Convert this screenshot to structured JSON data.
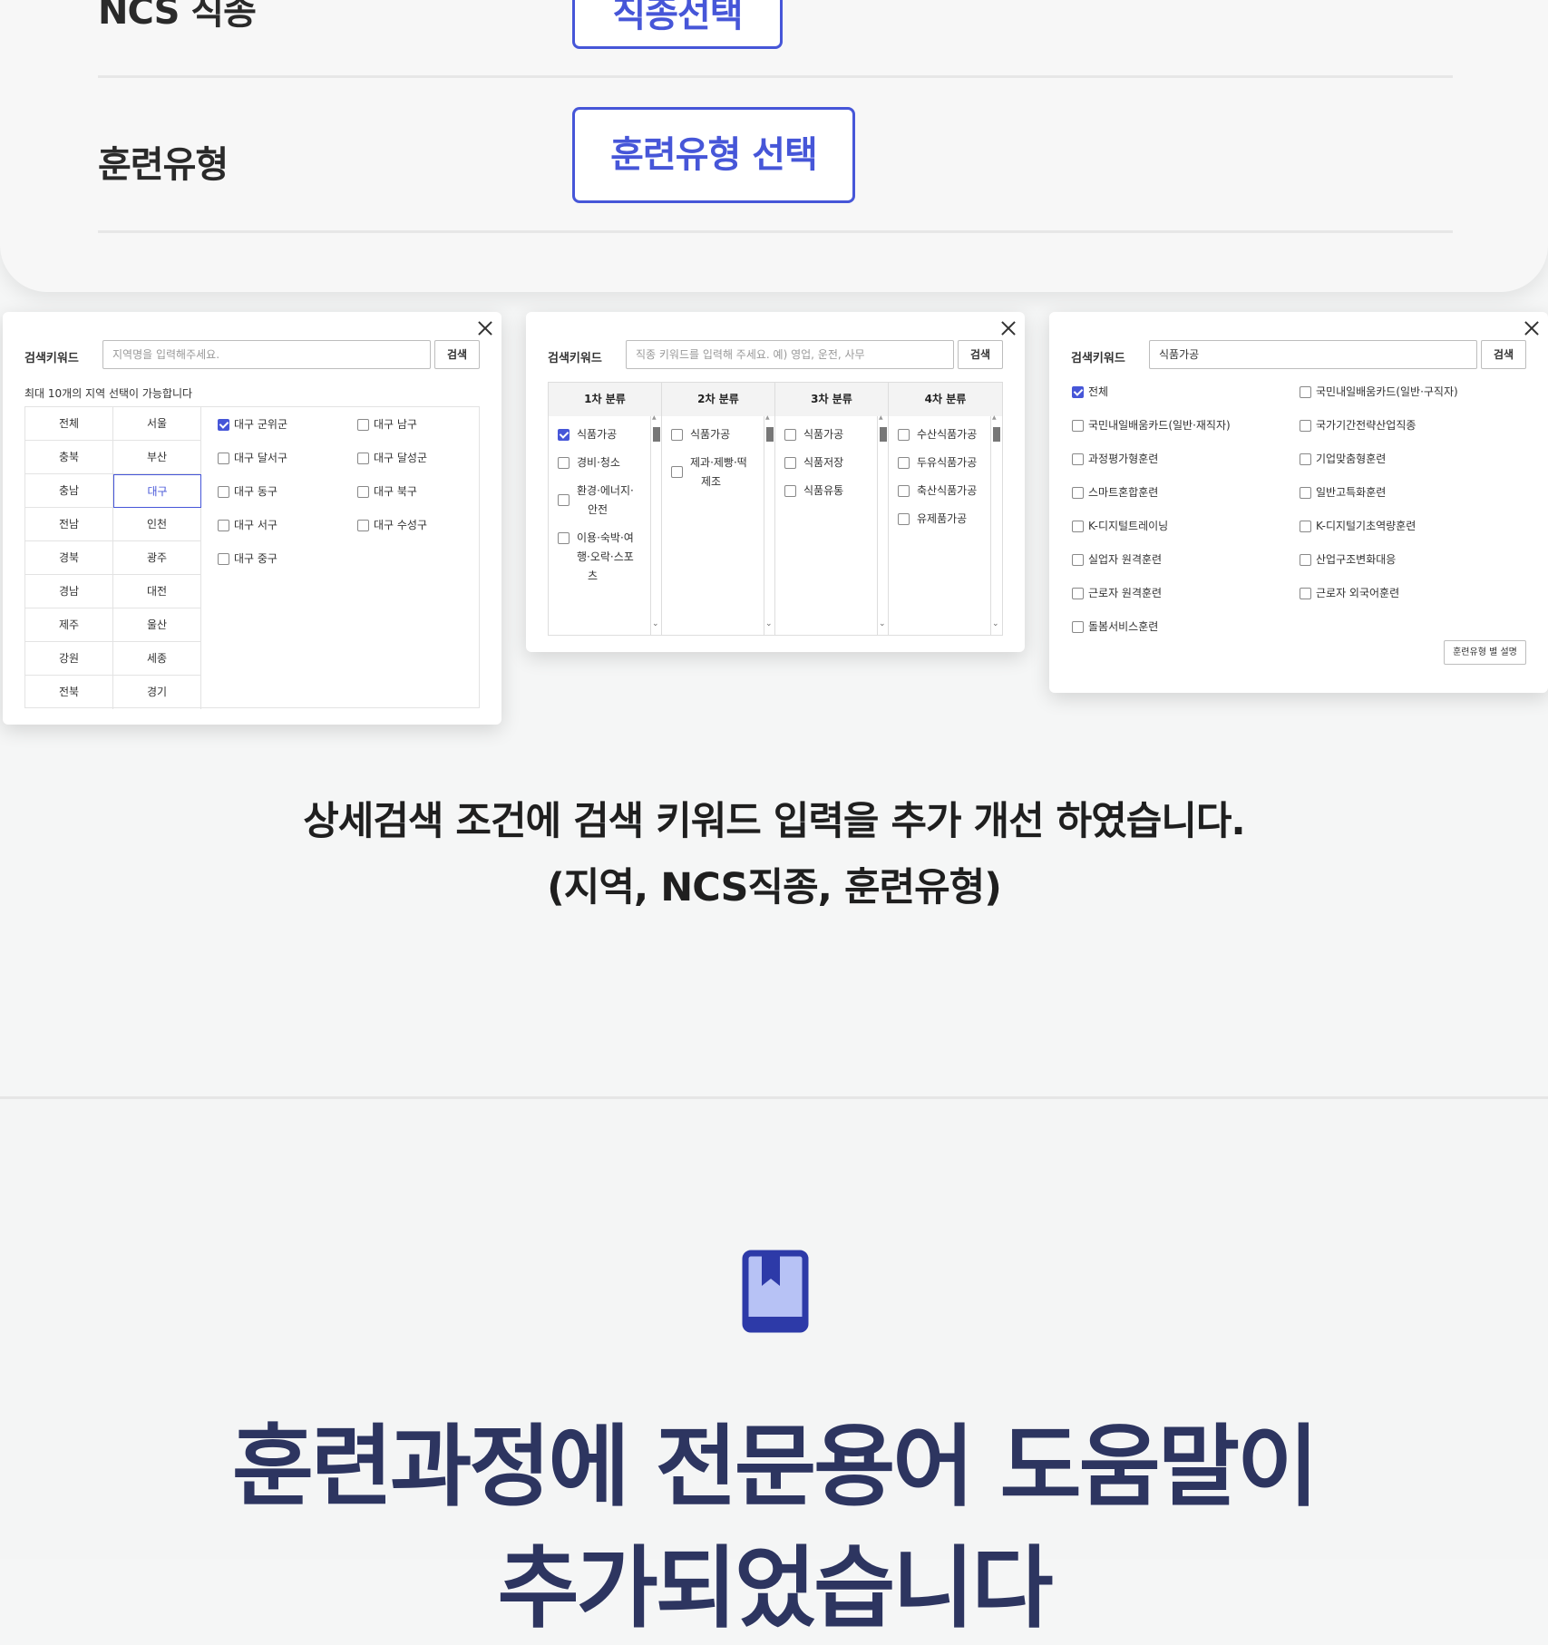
{
  "top_form": {
    "ncs_label": "NCS 직종",
    "ncs_button": "직종선택",
    "training_type_label": "훈련유형",
    "training_type_button": "훈련유형 선택"
  },
  "region_dialog": {
    "keyword_label": "검색키워드",
    "input_placeholder": "지역명을 입력해주세요.",
    "search_button": "검색",
    "note": "최대 10개의 지역 선택이 가능합니다",
    "regions_col1": [
      "전체",
      "충북",
      "충남",
      "전남",
      "경북",
      "경남",
      "제주",
      "강원",
      "전북"
    ],
    "regions_col2": [
      "서울",
      "부산",
      "대구",
      "인천",
      "광주",
      "대전",
      "울산",
      "세종",
      "경기"
    ],
    "selected_region": "대구",
    "districts": [
      {
        "label": "대구 군위군",
        "checked": true
      },
      {
        "label": "대구 남구",
        "checked": false
      },
      {
        "label": "대구 달서구",
        "checked": false
      },
      {
        "label": "대구 달성군",
        "checked": false
      },
      {
        "label": "대구 동구",
        "checked": false
      },
      {
        "label": "대구 북구",
        "checked": false
      },
      {
        "label": "대구 서구",
        "checked": false
      },
      {
        "label": "대구 수성구",
        "checked": false
      },
      {
        "label": "대구 중구",
        "checked": false
      }
    ]
  },
  "ncs_dialog": {
    "keyword_label": "검색키워드",
    "input_placeholder": "직종 키워드를 입력해 주세요. 예) 영업, 운전, 사무",
    "search_button": "검색",
    "col_headers": [
      "1차 분류",
      "2차 분류",
      "3차 분류",
      "4차 분류"
    ],
    "col1": [
      {
        "lines": [
          "식품가공"
        ],
        "checked": true
      },
      {
        "lines": [
          "경비·청소"
        ],
        "checked": false
      },
      {
        "lines": [
          "환경·에너지·",
          "안전"
        ],
        "checked": false
      },
      {
        "lines": [
          "이용·숙박·여",
          "행·오락·스포",
          "츠"
        ],
        "checked": false
      }
    ],
    "col2": [
      {
        "lines": [
          "식품가공"
        ],
        "checked": false
      },
      {
        "lines": [
          "제과·제빵·떡",
          "제조"
        ],
        "checked": false
      }
    ],
    "col3": [
      {
        "lines": [
          "식품가공"
        ],
        "checked": false
      },
      {
        "lines": [
          "식품저장"
        ],
        "checked": false
      },
      {
        "lines": [
          "식품유통"
        ],
        "checked": false
      }
    ],
    "col4": [
      {
        "lines": [
          "수산식품가공"
        ],
        "checked": false
      },
      {
        "lines": [
          "두유식품가공"
        ],
        "checked": false
      },
      {
        "lines": [
          "축산식품가공"
        ],
        "checked": false
      },
      {
        "lines": [
          "유제품가공"
        ],
        "checked": false
      }
    ]
  },
  "type_dialog": {
    "keyword_label": "검색키워드",
    "input_value": "식품가공",
    "search_button": "검색",
    "left_options": [
      {
        "label": "전체",
        "checked": true
      },
      {
        "label": "국민내일배움카드(일반·재직자)",
        "checked": false
      },
      {
        "label": "과정평가형훈련",
        "checked": false
      },
      {
        "label": "스마트혼합훈련",
        "checked": false
      },
      {
        "label": "K-디지털트레이닝",
        "checked": false
      },
      {
        "label": "실업자 원격훈련",
        "checked": false
      },
      {
        "label": "근로자 원격훈련",
        "checked": false
      },
      {
        "label": "돌봄서비스훈련",
        "checked": false
      }
    ],
    "right_options": [
      {
        "label": "국민내일배움카드(일반·구직자)",
        "checked": false
      },
      {
        "label": "국가기간전략산업직종",
        "checked": false
      },
      {
        "label": "기업맞춤형훈련",
        "checked": false
      },
      {
        "label": "일반고특화훈련",
        "checked": false
      },
      {
        "label": "K-디지털기초역량훈련",
        "checked": false
      },
      {
        "label": "산업구조변화대응",
        "checked": false
      },
      {
        "label": "근로자 외국어훈련",
        "checked": false
      }
    ],
    "explain_button": "훈련유형 별 설명"
  },
  "caption": {
    "line1": "상세검색 조건에 검색 키워드 입력을 추가 개선 하였습니다.",
    "line2": "(지역, NCS직종, 훈련유형)"
  },
  "section2": {
    "icon": "bookmark-book-icon",
    "headline_line1": "훈련과정에 전문용어 도움말이",
    "headline_line2": "추가되었습니다"
  },
  "colors": {
    "accent": "#4656d8",
    "headline": "#2d3560",
    "icon_fill": "#b7c2f5"
  }
}
